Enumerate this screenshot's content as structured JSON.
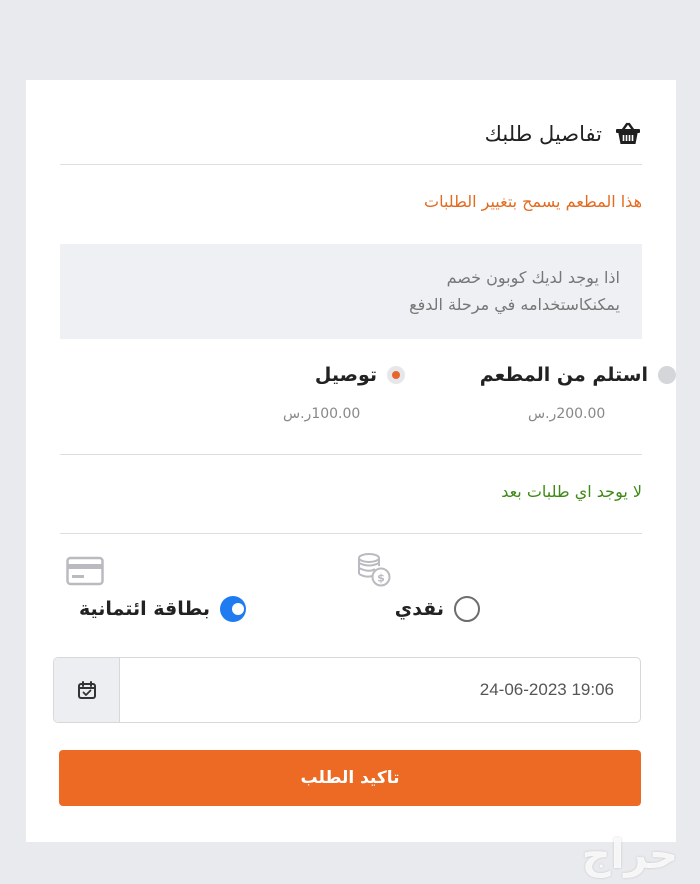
{
  "header": {
    "title": "تفاصيل طلبك",
    "icon": "basket-icon"
  },
  "notice": {
    "text": "هذا المطعم يسمح بتغيير الطلبات",
    "color": "#e46a1f"
  },
  "coupon": {
    "line1": "اذا يوجد لديك كوبون خصم",
    "line2": "يمكنكاستخدامه في مرحلة الدفع"
  },
  "delivery_options": {
    "pickup": {
      "label": "استلم من المطعم",
      "price": "200.00ر.س",
      "selected": false
    },
    "delivery": {
      "label": "توصيل",
      "price": "100.00ر.س",
      "selected": true
    }
  },
  "empty_orders": {
    "text": "لا يوجد اي طلبات بعد",
    "color": "#3f8a17"
  },
  "payment": {
    "cash": {
      "label": "نقدي",
      "icon": "coins-icon",
      "selected": false
    },
    "card": {
      "label": "بطاقة ائتمانية",
      "icon": "credit-card-icon",
      "selected": true
    }
  },
  "datetime": {
    "value": "24-06-2023 19:06",
    "icon": "calendar-icon"
  },
  "confirm": {
    "label": "تاكيد الطلب",
    "color": "#ec6a23"
  },
  "watermark": {
    "text": "حراج"
  }
}
